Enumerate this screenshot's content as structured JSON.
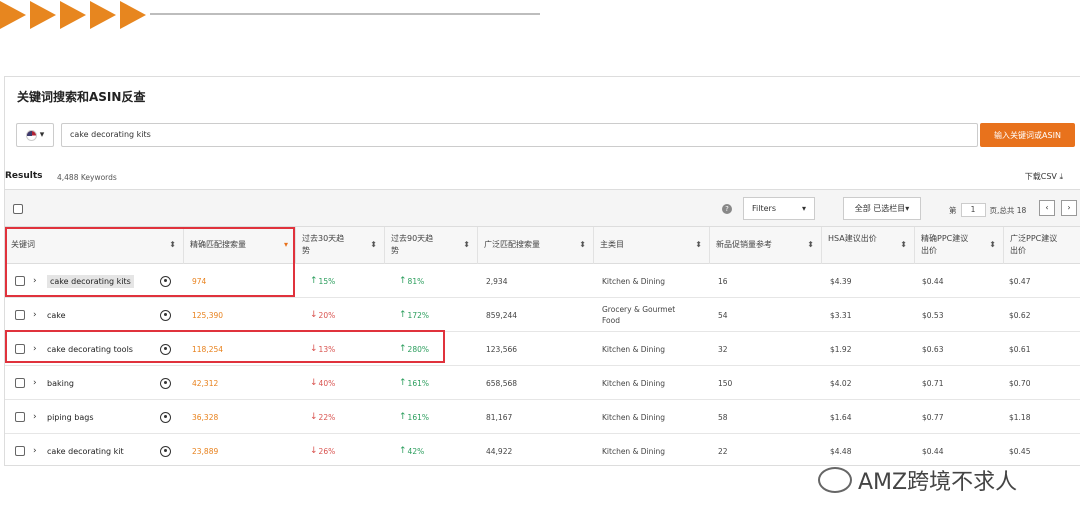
{
  "panel": {
    "title": "关键词搜索和ASIN反查"
  },
  "search": {
    "value": "cake decorating kits",
    "button_label": "输入关键词或ASIN"
  },
  "results": {
    "label": "Results",
    "count": "4,488 Keywords",
    "download": "下载CSV"
  },
  "toolbar": {
    "filters_label": "Filters",
    "columns_label": "全部 已选栏目",
    "page_prefix": "第",
    "page_value": "1",
    "page_suffix": "页,总共 18"
  },
  "columns": [
    "关键词",
    "精确匹配搜索量",
    "过去30天趋势",
    "过去90天趋势",
    "广泛匹配搜索量",
    "主类目",
    "新品促销量参考",
    "HSA建议出价",
    "精确PPC建议出价",
    "广泛PPC建议出价"
  ],
  "rows": [
    {
      "keyword": "cake decorating kits",
      "exact": "974",
      "t30": "15%",
      "t30dir": "up",
      "t90": "81%",
      "t90dir": "up",
      "broad": "2,934",
      "category": "Kitchen & Dining",
      "promo": "16",
      "hsa": "$4.39",
      "exact_ppc": "$0.44",
      "broad_ppc": "$0.47"
    },
    {
      "keyword": "cake",
      "exact": "125,390",
      "t30": "20%",
      "t30dir": "down",
      "t90": "172%",
      "t90dir": "up",
      "broad": "859,244",
      "category": "Grocery & Gourmet Food",
      "promo": "54",
      "hsa": "$3.31",
      "exact_ppc": "$0.53",
      "broad_ppc": "$0.62"
    },
    {
      "keyword": "cake decorating tools",
      "exact": "118,254",
      "t30": "13%",
      "t30dir": "down",
      "t90": "280%",
      "t90dir": "up",
      "broad": "123,566",
      "category": "Kitchen & Dining",
      "promo": "32",
      "hsa": "$1.92",
      "exact_ppc": "$0.63",
      "broad_ppc": "$0.61"
    },
    {
      "keyword": "baking",
      "exact": "42,312",
      "t30": "40%",
      "t30dir": "down",
      "t90": "161%",
      "t90dir": "up",
      "broad": "658,568",
      "category": "Kitchen & Dining",
      "promo": "150",
      "hsa": "$4.02",
      "exact_ppc": "$0.71",
      "broad_ppc": "$0.70"
    },
    {
      "keyword": "piping bags",
      "exact": "36,328",
      "t30": "22%",
      "t30dir": "down",
      "t90": "161%",
      "t90dir": "up",
      "broad": "81,167",
      "category": "Kitchen & Dining",
      "promo": "58",
      "hsa": "$1.64",
      "exact_ppc": "$0.77",
      "broad_ppc": "$1.18"
    },
    {
      "keyword": "cake decorating kit",
      "exact": "23,889",
      "t30": "26%",
      "t30dir": "down",
      "t90": "42%",
      "t90dir": "up",
      "broad": "44,922",
      "category": "Kitchen & Dining",
      "promo": "22",
      "hsa": "$4.48",
      "exact_ppc": "$0.44",
      "broad_ppc": "$0.45"
    }
  ],
  "watermark": "AMZ跨境不求人",
  "colors": {
    "accent": "#e8721c",
    "highlight_box": "#e0323c",
    "up": "#2a9d5c",
    "down": "#d9534f"
  }
}
